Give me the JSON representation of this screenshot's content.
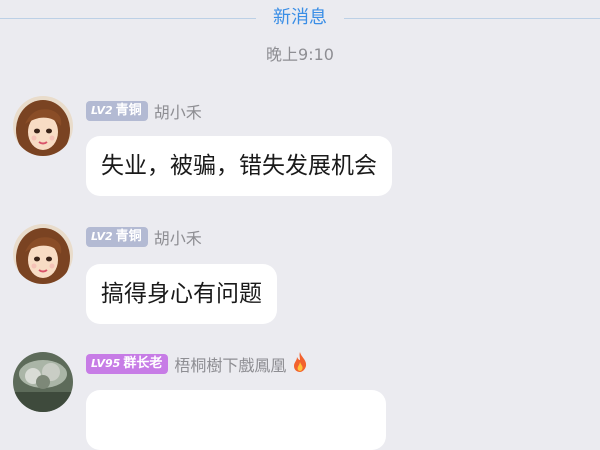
{
  "divider": {
    "label": "新消息"
  },
  "timestamp": "晚上9:10",
  "messages": [
    {
      "badge_level": "LV2",
      "badge_title": "青铜",
      "sender": "胡小禾",
      "text": "失业，被骗，错失发展机会",
      "avatar": "female-avatar-icon"
    },
    {
      "badge_level": "LV2",
      "badge_title": "青铜",
      "sender": "胡小禾",
      "text": "搞得身心有问题",
      "avatar": "female-avatar-icon"
    },
    {
      "badge_level": "LV95",
      "badge_title": "群长老",
      "sender": "梧桐樹下戲鳳凰",
      "text": "",
      "avatar": "landscape-avatar-icon",
      "flair": "fire-icon"
    }
  ],
  "colors": {
    "background": "#ebebf0",
    "divider_label": "#3a8ee6",
    "badge_bronze": "#b3bad3",
    "badge_owner": "#c77ce6",
    "sender_text": "#8e8e93"
  }
}
